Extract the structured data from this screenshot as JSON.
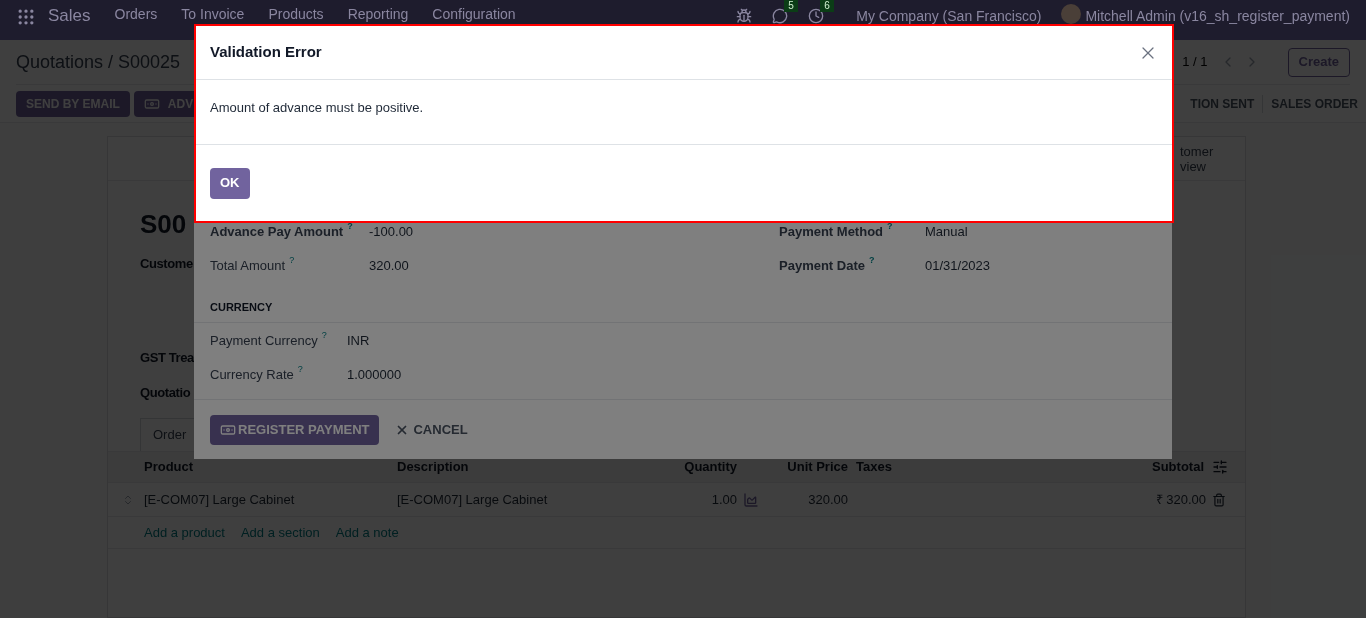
{
  "navbar": {
    "app": "Sales",
    "menu": [
      "Orders",
      "To Invoice",
      "Products",
      "Reporting",
      "Configuration"
    ],
    "messages_count": "5",
    "activities_count": "6",
    "company": "My Company (San Francisco)",
    "user": "Mitchell Admin (v16_sh_register_payment)"
  },
  "control_panel": {
    "breadcrumb": "Quotations / S00025",
    "pager": "1 / 1",
    "create": "Create"
  },
  "action_buttons": [
    {
      "label": "SEND BY EMAIL",
      "kind": "plain"
    },
    {
      "label": "ADV",
      "kind": "money"
    }
  ],
  "status_stages": [
    "TION SENT",
    "SALES ORDER"
  ],
  "form": {
    "smart_button": [
      "tomer",
      "view"
    ],
    "title": "S00",
    "labels": [
      "Custome",
      "GST Trea",
      "Quotatio"
    ],
    "tab": "Order",
    "table": {
      "columns": [
        "Product",
        "Description",
        "Quantity",
        "Unit Price",
        "Taxes",
        "Subtotal"
      ],
      "rows": [
        {
          "product": "[E-COM07] Large Cabinet",
          "description": "[E-COM07] Large Cabinet",
          "quantity": "1.00",
          "unit_price": "320.00",
          "subtotal": "₹ 320.00"
        }
      ],
      "add_links": [
        "Add a product",
        "Add a section",
        "Add a note"
      ]
    }
  },
  "payment_dialog": {
    "fields_left": [
      {
        "label": "Advance Pay Amount",
        "help": "?",
        "value": "-100.00",
        "required": true
      },
      {
        "label": "Total Amount",
        "help": "?",
        "value": "320.00",
        "required": false
      }
    ],
    "fields_right": [
      {
        "label": "Payment Method",
        "help": "?",
        "value": "Manual",
        "required": true
      },
      {
        "label": "Payment Date",
        "help": "?",
        "value": "01/31/2023",
        "required": true
      }
    ],
    "section": "CURRENCY",
    "currency_fields": [
      {
        "label": "Payment Currency",
        "help": "?",
        "value": "INR",
        "required": false
      },
      {
        "label": "Currency Rate",
        "help": "?",
        "value": "1.000000",
        "required": false
      }
    ],
    "buttons": [
      {
        "label": "REGISTER PAYMENT",
        "kind": "primary"
      },
      {
        "label": "CANCEL",
        "kind": "link"
      }
    ]
  },
  "error_dialog": {
    "title": "Validation Error",
    "message": "Amount of advance must be positive.",
    "button": "OK"
  }
}
